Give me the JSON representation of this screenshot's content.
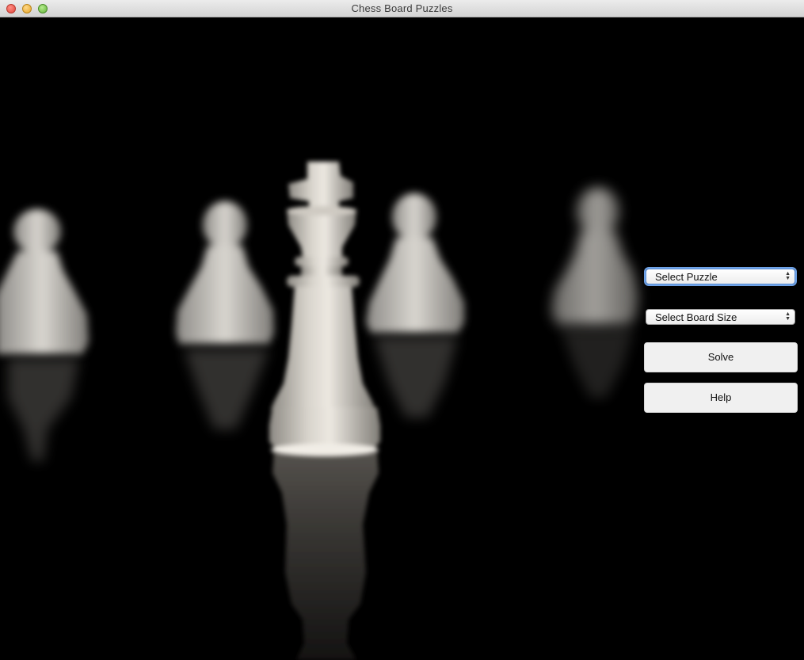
{
  "window": {
    "title": "Chess Board Puzzles"
  },
  "controls": {
    "puzzle_select": {
      "selected": "Select Puzzle"
    },
    "board_size_select": {
      "selected": "Select Board Size"
    },
    "solve_label": "Solve",
    "help_label": "Help"
  },
  "colors": {
    "background": "#000000",
    "piece_light": "#e6e1da",
    "button_bg": "#f0f0f0",
    "focus_ring": "#6fa2e6"
  },
  "image": {
    "subject": "chess-king-and-pawns-photo"
  }
}
